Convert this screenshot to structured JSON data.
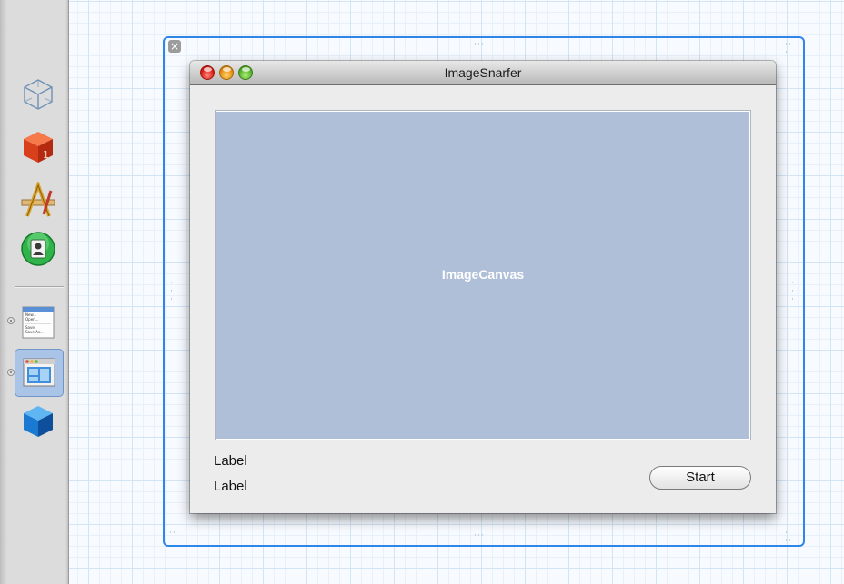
{
  "window": {
    "title": "ImageSnarfer",
    "controls": [
      "close",
      "minimize",
      "zoom"
    ]
  },
  "canvas": {
    "label": "ImageCanvas",
    "color": "#b0bfd8"
  },
  "labels": [
    "Label",
    "Label"
  ],
  "buttons": {
    "start": "Start"
  },
  "dock": {
    "items": [
      "wireframe-cube-icon",
      "red-cube-icon",
      "app-builder-icon",
      "green-user-icon",
      "main-menu-icon",
      "window-icon",
      "blue-cube-icon"
    ],
    "menu_thumbnail_lines": [
      "New...",
      "Open...",
      "Save",
      "Save As..."
    ]
  },
  "colors": {
    "selection": "#2e86ea",
    "grid": "#d3e4f5"
  }
}
